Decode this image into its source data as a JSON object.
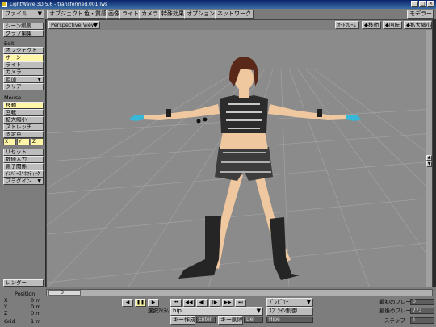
{
  "window": {
    "title": "LightWave 3D 5.6 - transformed.001.lws"
  },
  "menubar": {
    "file": "ファイル",
    "tabs": [
      "オブジェクト",
      "色・質感",
      "画像",
      "ライト",
      "カメラ",
      "特殊効果",
      "オプション",
      "ネットワーク"
    ],
    "modeler": "モデラー"
  },
  "sidebar": {
    "top": [
      "シーン編集",
      "グラフ編集"
    ],
    "edit_header": "Edit",
    "edit_items": [
      {
        "label": "オブジェクト",
        "selected": false,
        "arrow": ""
      },
      {
        "label": "ボーン",
        "selected": true,
        "arrow": ""
      },
      {
        "label": "ライト",
        "selected": false,
        "arrow": ""
      },
      {
        "label": "カメラ",
        "selected": false,
        "arrow": ""
      },
      {
        "label": "追加",
        "selected": false,
        "arrow": "▼"
      },
      {
        "label": "クリア",
        "selected": false,
        "arrow": ""
      }
    ],
    "mouse_header": "Mouse",
    "mouse_items": [
      {
        "label": "移動",
        "selected": true
      },
      {
        "label": "回転",
        "selected": false
      },
      {
        "label": "拡大縮小",
        "selected": false
      },
      {
        "label": "ストレッチ",
        "selected": false
      },
      {
        "label": "固定点",
        "selected": false
      }
    ],
    "axes": [
      "X",
      "Y",
      "Z"
    ],
    "bottom_items": [
      {
        "label": "リセット",
        "arrow": ""
      },
      {
        "label": "数値入力",
        "arrow": ""
      },
      {
        "label": "親子関係",
        "arrow": ""
      },
      {
        "label": "ｲﾝﾊﾞｰｽｷﾈﾏﾃｨｯｸ",
        "arrow": ""
      },
      {
        "label": "プラグイン",
        "arrow": "▼"
      }
    ],
    "render": "レンダー",
    "position_header": "Position",
    "position": [
      {
        "axis": "X",
        "value": "0 m"
      },
      {
        "axis": "Y",
        "value": "0 m"
      },
      {
        "axis": "Z",
        "value": "0 m"
      }
    ],
    "grid_label": "Grid",
    "grid_value": "1 m"
  },
  "viewport": {
    "view_mode": "Perspective View",
    "right_buttons": [
      "ｵｰﾄﾌﾚｰﾑ",
      "移動",
      "回転",
      "拡大縮小"
    ],
    "scroll_up": "▲",
    "scroll_down": "▼"
  },
  "timeline": {
    "current_frame": "0",
    "transport": [
      "◀",
      "❚❚",
      "▶",
      "⏮",
      "◀◀",
      "◀|",
      "|▶",
      "▶▶",
      "⏭"
    ],
    "select_item_label": "選択ｱｲﾃﾑ",
    "select_item_value": "hip",
    "preview": "ﾌﾟﾚﾋﾞｭｰ",
    "spline_control": "ｽﾌﾟﾗｲﾝ制御",
    "key_create": "キー作成",
    "key_create_field": "Enter",
    "key_delete": "キー削除",
    "key_delete_field": "Del",
    "key_field3": "Hipe",
    "first_frame_label": "最初のフレーム",
    "first_frame_value": "0",
    "last_frame_label": "最後のフレーム",
    "last_frame_value": "773",
    "step_label": "ステップ",
    "step_value": "1"
  },
  "colors": {
    "panel": "#7d7d7d",
    "button": "#bcbcbc",
    "selected": "#fff6a8",
    "viewport": "#8a8a8a",
    "grid": "#9a9a9a",
    "skin": "#f0c8a0",
    "hair": "#5a2818",
    "clothes": "#303030",
    "glove": "#38b8d8"
  }
}
